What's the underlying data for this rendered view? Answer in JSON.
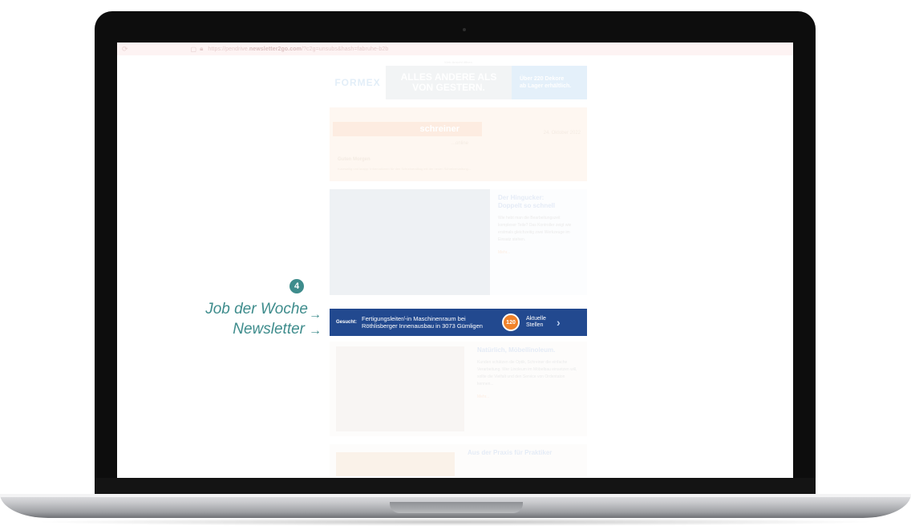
{
  "browser": {
    "reload_icon": "reload-icon",
    "shield_icon": "shield-icon",
    "lock_icon": "lock-icon",
    "url_prefix": "https://pendrive.",
    "url_domain": "newsletter2go.com",
    "url_suffix": "/?c2g=unsubs&hash=fabruhe-b2b"
  },
  "newsletter": {
    "topline": "Web-Ansicht öffnen",
    "banner": {
      "brand": "FORMEX",
      "headline1": "ALLES ANDERE ALS",
      "headline2": "VON GESTERN.",
      "side1": "Über 220 Dekore",
      "side2": "ab Lager erhältlich."
    },
    "hero": {
      "logo": "schreiner",
      "online": "...online",
      "date": "24. Oktober 2022",
      "greeting": "Guten Morgen",
      "intro": "Kurzweilig und knapp: Informationen für den Schreineralltag mit der neuen Schreinerzeitung..."
    },
    "article1": {
      "title1": "Der Hingucker:",
      "title2": "Doppelt so schnell",
      "body": "Wie hebt man die Bearbeitungszeit komplexer Teile? Das Kontroller zeigt wie erstmals gleichzeitig zwei Werkzeuge im Einsatz stehen.",
      "more": "Mehr..."
    },
    "article2": {
      "title": "Natürlich, Möbellinoleum.",
      "body": "Kunden schätzen die Optik, Schreiner die einfache Verarbeitung. Wer Linoleum im Möbelbau einsetzen will, sollte die Vielfalt und den Service von Ordentaton kennen...",
      "more": "Mehr..."
    },
    "article3": {
      "title": "Aus der Praxis für Praktiker"
    }
  },
  "job_bar": {
    "gesucht": "Gesucht:",
    "line1": "Fertigungsleiter/-in Maschinenraum bei",
    "line2": "Röthlisberger Innenausbau in 3073 Gümligen",
    "count": "120",
    "stellen1": "Aktuelle",
    "stellen2": "Stellen",
    "chevron_icon": "chevron-right-icon"
  },
  "annotation": {
    "number": "4",
    "line1": "Job der Woche",
    "line2": "Newsletter",
    "arrow_icon": "arrow-right-icon"
  },
  "colors": {
    "accent": "#3e8c8c",
    "job_bar": "#22498f",
    "count_badge": "#f0822a"
  }
}
